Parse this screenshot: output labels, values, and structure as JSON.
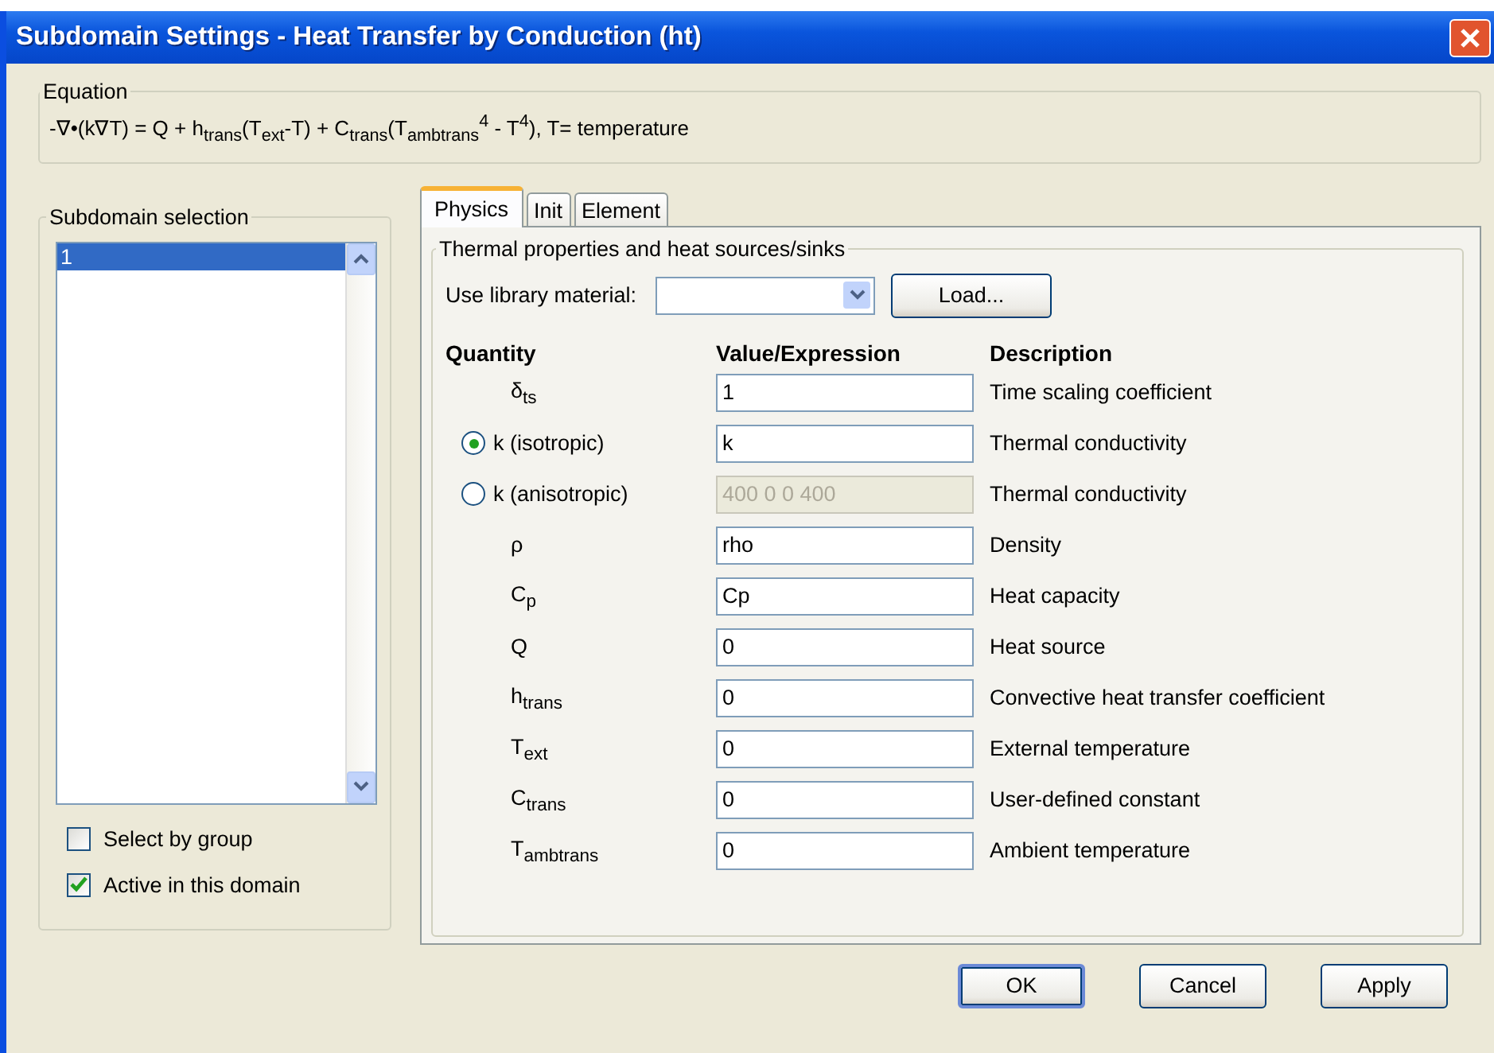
{
  "window": {
    "title": "Subdomain Settings - Heat Transfer by Conduction (ht)"
  },
  "equation": {
    "label": "Equation",
    "text": "-∇•(k∇T) = Q + h$_{trans}$(T$_{ext}$-T) + C$_{trans}$(T$_{ambtrans}$$^{4}$ - T$^{4}$), T= temperature"
  },
  "subdomain_selection": {
    "label": "Subdomain selection",
    "items": [
      {
        "label": "1",
        "selected": true
      }
    ],
    "checkboxes": [
      {
        "label": "Select by group",
        "checked": false
      },
      {
        "label": "Active in this domain",
        "checked": true
      }
    ]
  },
  "tabs": [
    {
      "label": "Physics",
      "selected": true
    },
    {
      "label": "Init",
      "selected": false
    },
    {
      "label": "Element",
      "selected": false
    }
  ],
  "group": {
    "label": "Thermal properties and heat sources/sinks",
    "library_label": "Use library material:",
    "load_button": "Load...",
    "columns": [
      "Quantity",
      "Value/Expression",
      "Description"
    ],
    "rows": [
      {
        "kind": "plain",
        "quantity": "δ$_{ts}$",
        "value": "1",
        "disabled": false,
        "description": "Time scaling coefficient"
      },
      {
        "kind": "radio",
        "selected": true,
        "quantity": "k (isotropic)",
        "value": "k",
        "disabled": false,
        "description": "Thermal conductivity"
      },
      {
        "kind": "radio",
        "selected": false,
        "quantity": "k (anisotropic)",
        "value": "400 0 0 400",
        "disabled": true,
        "description": "Thermal conductivity"
      },
      {
        "kind": "plain",
        "quantity": "ρ",
        "value": "rho",
        "disabled": false,
        "description": "Density"
      },
      {
        "kind": "plain",
        "quantity": "C$_{p}$",
        "value": "Cp",
        "disabled": false,
        "description": "Heat capacity"
      },
      {
        "kind": "plain",
        "quantity": "Q",
        "value": "0",
        "disabled": false,
        "description": "Heat source"
      },
      {
        "kind": "plain",
        "quantity": "h$_{trans}$",
        "value": "0",
        "disabled": false,
        "description": "Convective heat transfer coefficient"
      },
      {
        "kind": "plain",
        "quantity": "T$_{ext}$",
        "value": "0",
        "disabled": false,
        "description": "External temperature"
      },
      {
        "kind": "plain",
        "quantity": "C$_{trans}$",
        "value": "0",
        "disabled": false,
        "description": "User-defined constant"
      },
      {
        "kind": "plain",
        "quantity": "T$_{ambtrans}$",
        "value": "0",
        "disabled": false,
        "description": "Ambient temperature"
      }
    ]
  },
  "buttons": [
    {
      "label": "OK",
      "default": true
    },
    {
      "label": "Cancel",
      "default": false
    },
    {
      "label": "Apply",
      "default": false
    }
  ]
}
